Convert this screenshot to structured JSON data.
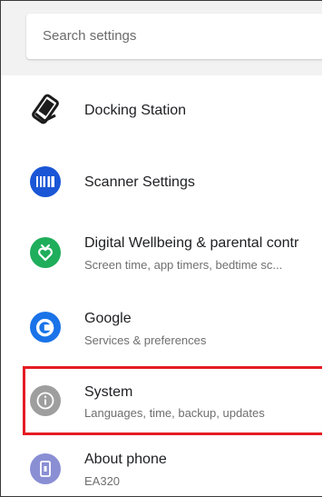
{
  "search": {
    "placeholder": "Search settings"
  },
  "items": [
    {
      "title": "Docking Station",
      "subtitle": "",
      "icon": "docking-station-icon"
    },
    {
      "title": "Scanner Settings",
      "subtitle": "",
      "icon": "barcode-scanner-icon"
    },
    {
      "title": "Digital Wellbeing & parental contr",
      "subtitle": "Screen time, app timers, bedtime sc...",
      "icon": "digital-wellbeing-icon"
    },
    {
      "title": "Google",
      "subtitle": "Services & preferences",
      "icon": "google-icon"
    },
    {
      "title": "System",
      "subtitle": "Languages, time, backup, updates",
      "icon": "info-icon"
    },
    {
      "title": "About phone",
      "subtitle": "EA320",
      "icon": "phone-icon"
    }
  ],
  "highlight_color": "#e51c23",
  "colors": {
    "scanner": "#1a56d6",
    "wellbeing": "#1fae5b",
    "google": "#1a73e8",
    "system": "#9e9e9e",
    "about": "#8a8fd4"
  }
}
